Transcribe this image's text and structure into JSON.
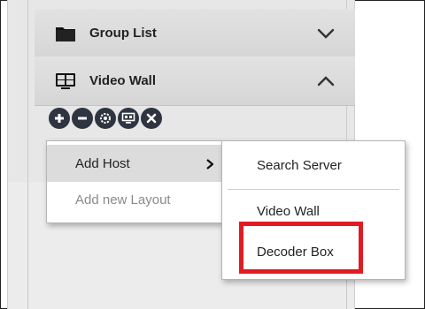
{
  "panel": {
    "group_list": {
      "label": "Group List",
      "icon": "folder-icon",
      "state": "collapsed"
    },
    "video_wall": {
      "label": "Video Wall",
      "icon": "video-wall-icon",
      "state": "expanded"
    }
  },
  "toolbar": {
    "buttons": [
      {
        "icon": "add-icon"
      },
      {
        "icon": "remove-icon"
      },
      {
        "icon": "settings-icon"
      },
      {
        "icon": "monitor-icon"
      },
      {
        "icon": "tools-icon"
      }
    ]
  },
  "context_menu": {
    "items": [
      {
        "label": "Add Host",
        "has_submenu": true,
        "state": "hover"
      },
      {
        "label": "Add new Layout",
        "state": "disabled"
      }
    ]
  },
  "submenu": {
    "items": [
      {
        "label": "Search Server"
      },
      {
        "label": "Video Wall"
      },
      {
        "label": "Decoder Box",
        "highlighted": true
      }
    ]
  },
  "colors": {
    "highlight": "#e11b22",
    "icon_dark": "#2e3440",
    "panel_bg": "#e7e7e7"
  }
}
